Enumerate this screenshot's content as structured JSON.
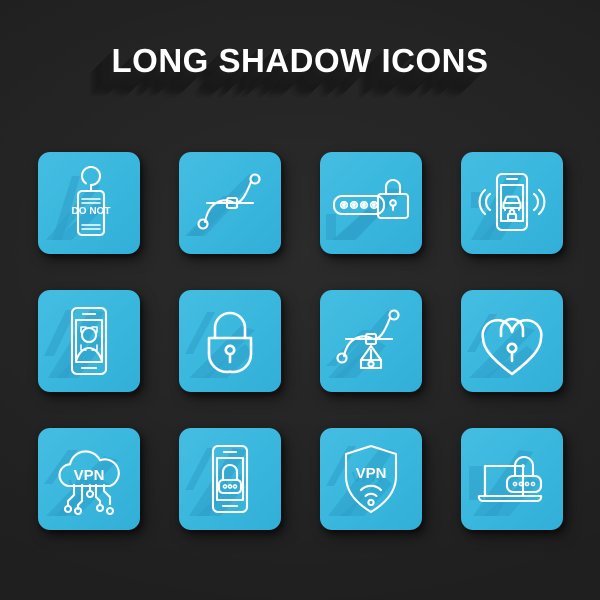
{
  "page": {
    "title": "LONG SHADOW ICONS",
    "background_color": "#262626",
    "tile_color": "#3bb8de",
    "icon_color": "#ffffff",
    "shadow_color": "#2e9fc9",
    "grid": {
      "columns": 4,
      "rows": 3,
      "tile_count": 12
    }
  },
  "icons": [
    {
      "index": 1,
      "name": "do-not-disturb-door-hanger-icon",
      "label": "Do Not Disturb door hanger",
      "text_on_icon": "DO NOT",
      "row": 1,
      "column": 1
    },
    {
      "index": 2,
      "name": "bezier-curve-icon",
      "label": "Bezier curve path with anchor points",
      "text_on_icon": "",
      "row": 1,
      "column": 2
    },
    {
      "index": 3,
      "name": "password-protection-icon",
      "label": "Password field with padlock",
      "text_on_icon": "",
      "row": 1,
      "column": 3
    },
    {
      "index": 4,
      "name": "smart-car-key-phone-icon",
      "label": "Smartphone car remote lock with signal waves",
      "text_on_icon": "",
      "row": 1,
      "column": 4
    },
    {
      "index": 5,
      "name": "face-recognition-phone-icon",
      "label": "Smartphone face ID recognition",
      "text_on_icon": "",
      "row": 2,
      "column": 1
    },
    {
      "index": 6,
      "name": "padlock-closed-icon",
      "label": "Closed padlock with keyhole",
      "text_on_icon": "",
      "row": 2,
      "column": 2
    },
    {
      "index": 7,
      "name": "pen-tool-bezier-icon",
      "label": "Pen tool nib with bezier curve",
      "text_on_icon": "",
      "row": 2,
      "column": 3
    },
    {
      "index": 8,
      "name": "heart-padlock-icon",
      "label": "Heart shaped padlock with keyhole",
      "text_on_icon": "",
      "row": 2,
      "column": 4
    },
    {
      "index": 9,
      "name": "vpn-cloud-network-icon",
      "label": "VPN cloud with network nodes",
      "text_on_icon": "VPN",
      "row": 3,
      "column": 1
    },
    {
      "index": 10,
      "name": "mobile-password-lock-icon",
      "label": "Smartphone with padlock and password dots",
      "text_on_icon": "",
      "row": 3,
      "column": 2
    },
    {
      "index": 11,
      "name": "vpn-shield-wifi-icon",
      "label": "VPN shield with WiFi signal",
      "text_on_icon": "VPN",
      "row": 3,
      "column": 3
    },
    {
      "index": 12,
      "name": "laptop-password-lock-icon",
      "label": "Laptop with padlock and password dots",
      "text_on_icon": "",
      "row": 3,
      "column": 4
    }
  ]
}
